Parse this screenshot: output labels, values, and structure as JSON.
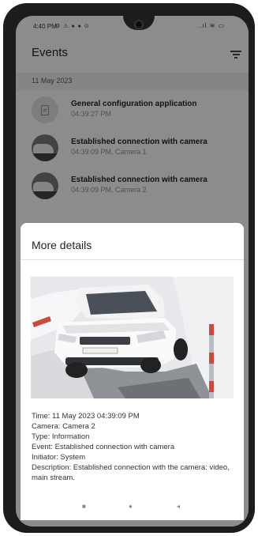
{
  "status_bar": {
    "time": "4:40 PM",
    "left_icons": "⚙ ⚠ ● ● ⊙",
    "right_icons": "..ıl ≋ ▭"
  },
  "app_bar": {
    "title": "Events",
    "filter_icon": "filter-icon"
  },
  "date_header": "11 May 2023",
  "events": [
    {
      "icon": "document-icon",
      "title": "General configuration application",
      "subtitle": "04:39:27 PM"
    },
    {
      "icon": "camera-thumbnail",
      "title": "Established connection with camera",
      "subtitle": "04:39:09 PM, Camera 1"
    },
    {
      "icon": "camera-thumbnail",
      "title": "Established connection with camera",
      "subtitle": "04:39:09 PM, Camera 2"
    }
  ],
  "details_sheet": {
    "title": "More details",
    "lines": [
      "Time: 11 May 2023 04:39:09 PM",
      "Camera: Camera 2",
      "Type: Information",
      "Event: Established connection with camera",
      "Initiator: System",
      "Description: Established connection with the camera: video, main stream."
    ]
  },
  "nav_keys": [
    "■",
    "●",
    "◂"
  ]
}
